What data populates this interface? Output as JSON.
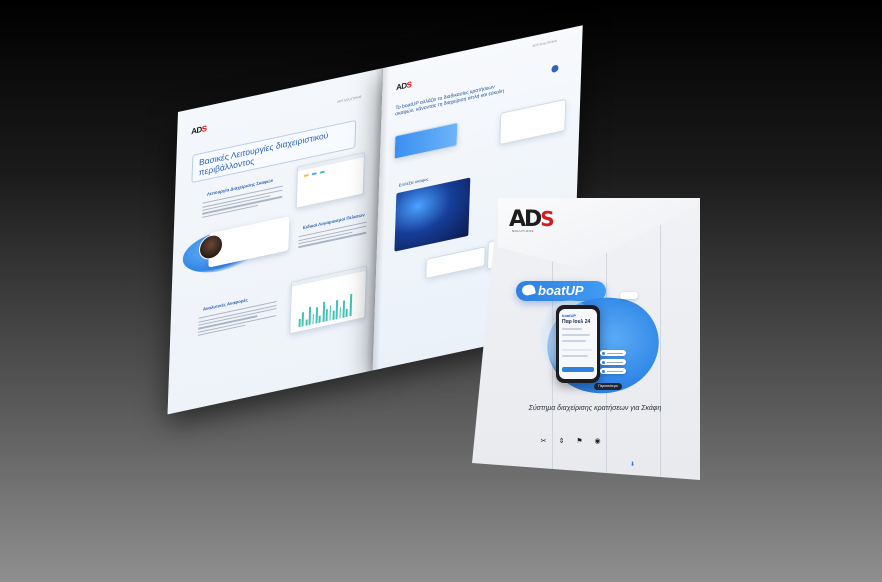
{
  "brochure_inner": {
    "header_tag_left": "ADS SOLUTIONS",
    "header_tag_right": "ADS SOLUTIONS",
    "section_title": "Βασικές Λειτουργίες διαχειριστικού περιβάλλοντος",
    "feature_1_title": "Λειτουργία Διαχείρισης Σκαφών",
    "feature_2_title": "Ειδικοί Λογαριασμοί Πελατών",
    "feature_3_title": "Αναλυτικές Αναφορές",
    "right_callout": "Το boatUP αλλάζει το διαδικασίες κρατήσεων σκαφών, κάνοντας τη διαχείριση απλή και εύκολη",
    "right_subtitle": "Επιλέξτε σκάφος"
  },
  "cover": {
    "logo_text": "AD",
    "logo_accent": "S",
    "logo_sub": "SOLUTIONS",
    "brand_name": "boatUP",
    "phone_header": "boatUP",
    "phone_date": "Παρ Ιουλ 24",
    "cta_label": "Περισσότερα",
    "tagline": "Σύστημα διαχείρισης κρατήσεων για Σκάφη",
    "icons": [
      "tools-icon",
      "arrows-icon",
      "flag-icon",
      "camera-icon"
    ]
  },
  "colors": {
    "accent_blue": "#2f7fe0",
    "logo_red": "#cf1f1f",
    "chart_teal": "#42c1b6"
  }
}
